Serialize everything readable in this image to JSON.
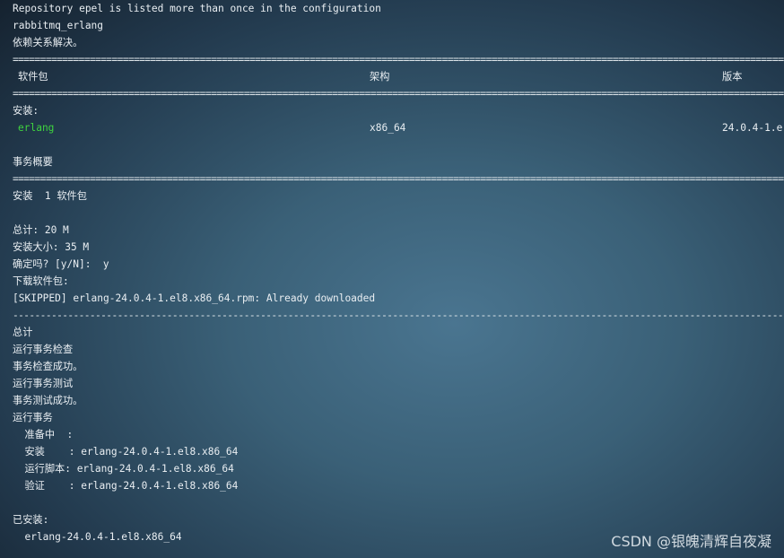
{
  "terminal": {
    "lines": {
      "l1": "Repository epel is listed more than once in the configuration",
      "l2": "rabbitmq_erlang",
      "l3": "依赖关系解决。",
      "install_section": "安装:",
      "summary": "事务概要",
      "install_count": "安装  1 软件包",
      "total": "总计: 20 M",
      "install_size": "安装大小: 35 M",
      "confirm": "确定吗? [y/N]:  y",
      "download": "下载软件包:",
      "skipped": "[SKIPPED] erlang-24.0.4-1.el8.x86_64.rpm: Already downloaded",
      "total2": "总计",
      "run_check": "运行事务检查",
      "check_ok": "事务检查成功。",
      "run_test": "运行事务测试",
      "test_ok": "事务测试成功。",
      "run_tx": "运行事务",
      "prepare": "  准备中  :",
      "installing": "  安装    : erlang-24.0.4-1.el8.x86_64",
      "scriptlet": "  运行脚本: erlang-24.0.4-1.el8.x86_64",
      "verify": "  验证    : erlang-24.0.4-1.el8.x86_64",
      "installed": "已安装:",
      "installed_pkg": "  erlang-24.0.4-1.el8.x86_64"
    },
    "table": {
      "header": {
        "package": "软件包",
        "arch": "架构",
        "version": "版本"
      },
      "row": {
        "package": "erlang",
        "arch": "x86_64",
        "version": "24.0.4-1.e"
      }
    },
    "rules": {
      "double": "======================================================================================================================================================",
      "single": "------------------------------------------------------------------------------------------------------------------------------------------------------"
    },
    "colors": {
      "package_name": "#3fd23f",
      "text": "#e9eef2"
    }
  },
  "watermark": {
    "text": "CSDN @银魄清辉自夜凝"
  }
}
